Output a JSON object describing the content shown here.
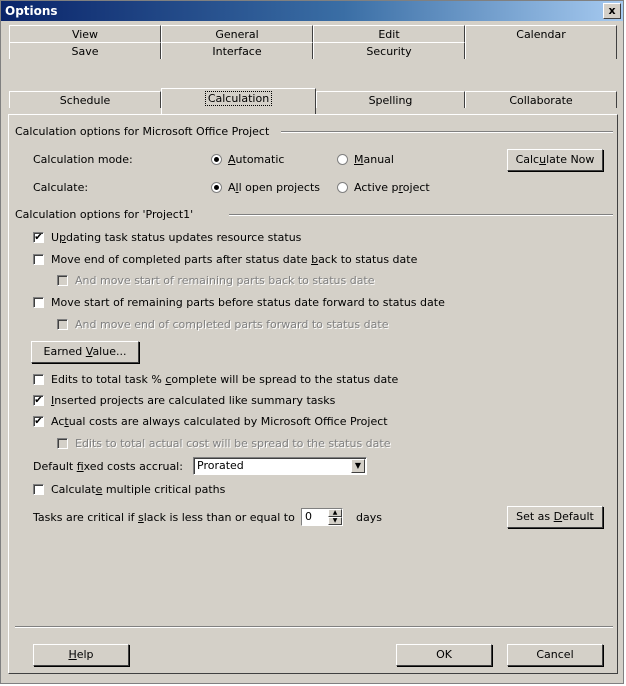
{
  "window": {
    "title": "Options",
    "close": "x"
  },
  "tabs": {
    "row1": [
      "View",
      "General",
      "Edit",
      "Calendar"
    ],
    "row2": [
      "Save",
      "Interface",
      "Security",
      ""
    ],
    "row3": [
      "Schedule",
      "Calculation",
      "Spelling",
      "Collaborate"
    ]
  },
  "group1": {
    "header": "Calculation options for Microsoft Office Project",
    "mode_label": "Calculation mode:",
    "mode_automatic": "Automatic",
    "mode_manual": "Manual",
    "calculate_label": "Calculate:",
    "calc_all": "All open projects",
    "calc_active": "Active project",
    "calc_now_button": "Calculate Now"
  },
  "group2": {
    "header": "Calculation options for 'Project1'",
    "opt_updating": "Updating task status updates resource status",
    "opt_move_end": "Move end of completed parts after status date back to status date",
    "opt_move_end_sub": "And move start of remaining parts back to status date",
    "opt_move_start": "Move start of remaining parts before status date forward to status date",
    "opt_move_start_sub": "And move end of completed parts forward to status date",
    "earned_value_button": "Earned Value...",
    "opt_edits_total": "Edits to total task % complete will be spread to the status date",
    "opt_inserted": "Inserted projects are calculated like summary tasks",
    "opt_actual_costs": "Actual costs are always calculated by Microsoft Office Project",
    "opt_actual_costs_sub": "Edits to total actual cost will be spread to the status date",
    "fixed_costs_label": "Default fixed costs accrual:",
    "fixed_costs_value": "Prorated",
    "opt_multiple_critical": "Calculate multiple critical paths",
    "critical_label": "Tasks are critical if slack is less than or equal to",
    "critical_value": "0",
    "critical_unit": "days",
    "set_default_button": "Set as Default"
  },
  "footer": {
    "help": "Help",
    "ok": "OK",
    "cancel": "Cancel"
  },
  "state": {
    "checked_glyph": "✔",
    "dropdown_glyph": "▼",
    "spin_up_glyph": "▲",
    "spin_down_glyph": "▼"
  }
}
